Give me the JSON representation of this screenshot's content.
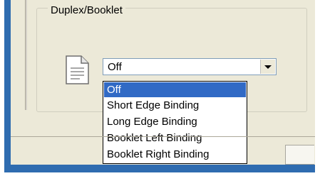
{
  "group": {
    "title": "Duplex/Booklet"
  },
  "duplex_combo": {
    "selected": "Off"
  },
  "duplex_options": [
    {
      "label": "Off",
      "highlighted": true
    },
    {
      "label": "Short Edge Binding",
      "highlighted": false
    },
    {
      "label": "Long Edge Binding",
      "highlighted": false
    },
    {
      "label": "Booklet Left Binding",
      "highlighted": false
    },
    {
      "label": "Booklet Right Binding",
      "highlighted": false
    }
  ],
  "icons": {
    "document": "document-icon",
    "dropdown": "chevron-down-icon"
  },
  "colors": {
    "selection": "#316ac5",
    "dialog_bg": "#ece9d8",
    "frame": "#2f6cb0"
  }
}
